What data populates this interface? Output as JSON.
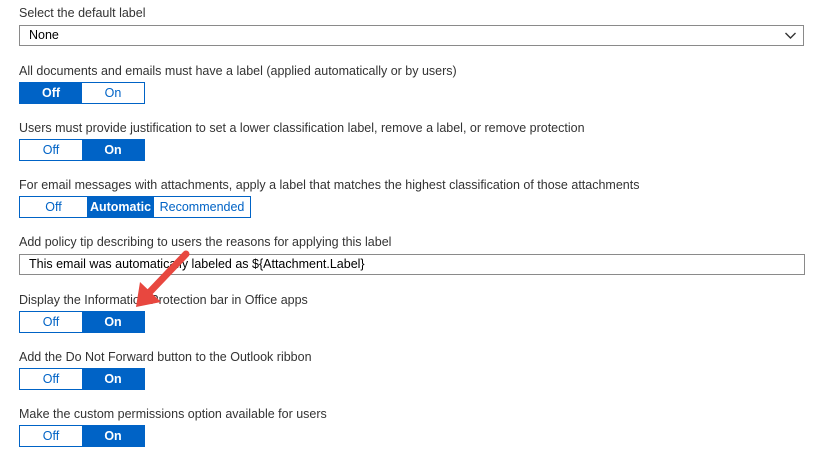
{
  "default_label": {
    "title": "Select the default label",
    "value": "None",
    "icon": "chevron-down-icon"
  },
  "mandatory_label": {
    "title": "All documents and emails must have a label (applied automatically or by users)",
    "options": [
      "Off",
      "On"
    ],
    "selected": "Off"
  },
  "justification": {
    "title": "Users must provide justification to set a lower classification label, remove a label, or remove protection",
    "options": [
      "Off",
      "On"
    ],
    "selected": "On"
  },
  "email_attachments": {
    "title": "For email messages with attachments, apply a label that matches the highest classification of those attachments",
    "options": [
      "Off",
      "Automatic",
      "Recommended"
    ],
    "selected": "Automatic"
  },
  "policy_tip": {
    "title": "Add policy tip describing to users the reasons for applying this label",
    "value": "This email was automatically labeled as ${Attachment.Label}"
  },
  "info_protection_bar": {
    "title": "Display the Information Protection bar in Office apps",
    "options": [
      "Off",
      "On"
    ],
    "selected": "On"
  },
  "do_not_forward": {
    "title": "Add the Do Not Forward button to the Outlook ribbon",
    "options": [
      "Off",
      "On"
    ],
    "selected": "On"
  },
  "custom_permissions": {
    "title": "Make the custom permissions option available for users",
    "options": [
      "Off",
      "On"
    ],
    "selected": "On"
  },
  "colors": {
    "accent": "#0063c6",
    "annotation_arrow": "#e8473f",
    "text": "#333333",
    "border": "#8a8a8a"
  }
}
